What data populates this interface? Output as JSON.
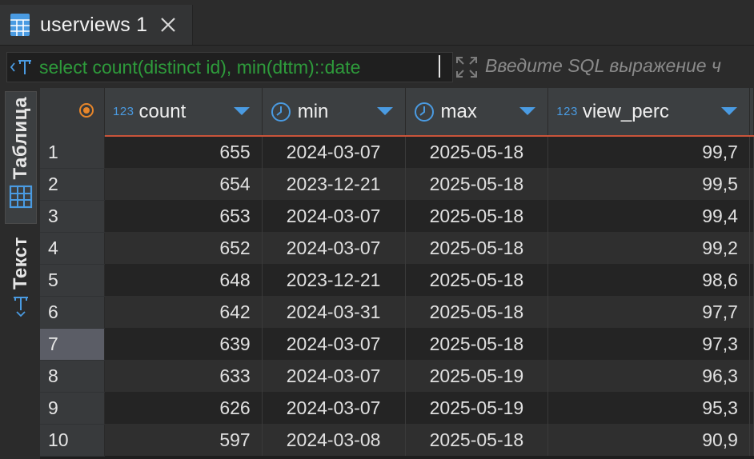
{
  "tab": {
    "title": "userviews 1"
  },
  "filter": {
    "query": "select count(distinct id), min(dttm)::date",
    "placeholder": "Введите SQL выражение ч"
  },
  "side_tabs": [
    {
      "label": "Таблица",
      "active": true
    },
    {
      "label": "Текст",
      "active": false
    }
  ],
  "columns": [
    {
      "name": "count",
      "type": "123"
    },
    {
      "name": "min",
      "type": "date"
    },
    {
      "name": "max",
      "type": "date"
    },
    {
      "name": "view_perc",
      "type": "123"
    }
  ],
  "rows": [
    {
      "n": "1",
      "count": "655",
      "min": "2024-03-07",
      "max": "2025-05-18",
      "view_perc": "99,7"
    },
    {
      "n": "2",
      "count": "654",
      "min": "2023-12-21",
      "max": "2025-05-18",
      "view_perc": "99,5"
    },
    {
      "n": "3",
      "count": "653",
      "min": "2024-03-07",
      "max": "2025-05-18",
      "view_perc": "99,4"
    },
    {
      "n": "4",
      "count": "652",
      "min": "2024-03-07",
      "max": "2025-05-18",
      "view_perc": "99,2"
    },
    {
      "n": "5",
      "count": "648",
      "min": "2023-12-21",
      "max": "2025-05-18",
      "view_perc": "98,6"
    },
    {
      "n": "6",
      "count": "642",
      "min": "2024-03-31",
      "max": "2025-05-18",
      "view_perc": "97,7"
    },
    {
      "n": "7",
      "count": "639",
      "min": "2024-03-07",
      "max": "2025-05-18",
      "view_perc": "97,3"
    },
    {
      "n": "8",
      "count": "633",
      "min": "2024-03-07",
      "max": "2025-05-19",
      "view_perc": "96,3"
    },
    {
      "n": "9",
      "count": "626",
      "min": "2024-03-07",
      "max": "2025-05-19",
      "view_perc": "95,3"
    },
    {
      "n": "10",
      "count": "597",
      "min": "2024-03-08",
      "max": "2025-05-18",
      "view_perc": "90,9"
    }
  ],
  "selected_row": 7,
  "colors": {
    "accent_blue": "#4a9be2",
    "query_green": "#2e9b3b",
    "header_underline": "#c9543a",
    "corner_marker": "#e8862a"
  },
  "icons": {
    "tab": "table-grid-icon",
    "close": "close-icon",
    "filter": "sql-filter-icon",
    "expand": "expand-icon",
    "corner": "record-marker-icon",
    "sort": "sort-down-icon",
    "date_type": "clock-icon"
  }
}
